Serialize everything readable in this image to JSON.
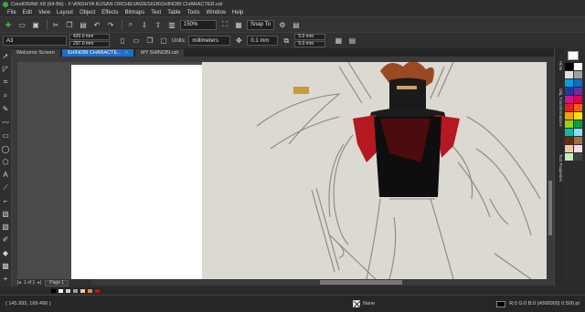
{
  "window": {
    "title": "CorelDRAW X8 (64-Bit) - F:\\ANDHYA KUSAN ORCHEVA\\DESIGN\\SHINOBI CHARACTER.cdr"
  },
  "menu": [
    "File",
    "Edit",
    "View",
    "Layout",
    "Object",
    "Effects",
    "Bitmaps",
    "Text",
    "Table",
    "Tools",
    "Window",
    "Help"
  ],
  "toolbar": {
    "zoom_value": "150%",
    "snap_label": "Snap To"
  },
  "property_bar": {
    "page_size": "A3",
    "width": "420.0 mm",
    "height": "297.0 mm",
    "units_label": "Units:",
    "units_value": "millimeters",
    "nudge": "0.1 mm",
    "dup_x": "5.0 mm",
    "dup_y": "5.0 mm"
  },
  "tabs": [
    {
      "label": "Welcome Screen"
    },
    {
      "label": "SHINOBI CHARACTE..."
    },
    {
      "label": "MY SHINOBI.cdr"
    }
  ],
  "page_nav": {
    "page_counter": "1 of 1",
    "page_tab": "Page 1"
  },
  "dockers": {
    "hints": "Hints",
    "object_manager": "Obj. Transformations",
    "text_properties": "Text Properties"
  },
  "status": {
    "coords": "( 145.993, 169.490 )",
    "fill_label": "None",
    "outline_label": "R:0 G:0 B:0 (#000000) 0.500 pt"
  },
  "colors": {
    "accent_tab": "#1e6fc9",
    "palette": [
      "#000000",
      "#ffffff",
      "#e0e0e0",
      "#a0a0a0",
      "#00a0e0",
      "#0070c0",
      "#1e3c96",
      "#6a2aa0",
      "#c8178c",
      "#e0004e",
      "#e02020",
      "#f06010",
      "#f8a000",
      "#ffe000",
      "#a0d000",
      "#00a040",
      "#00c0a0",
      "#80e0ff",
      "#603010",
      "#a07040",
      "#f0c8a0",
      "#ffd8e8",
      "#c0f0c0",
      "#404040"
    ],
    "document_palette": [
      "#000000",
      "#ffffff",
      "#cfcfcf",
      "#9e9e9e",
      "#f4c8a0",
      "#e08848",
      "#c0141c"
    ]
  }
}
